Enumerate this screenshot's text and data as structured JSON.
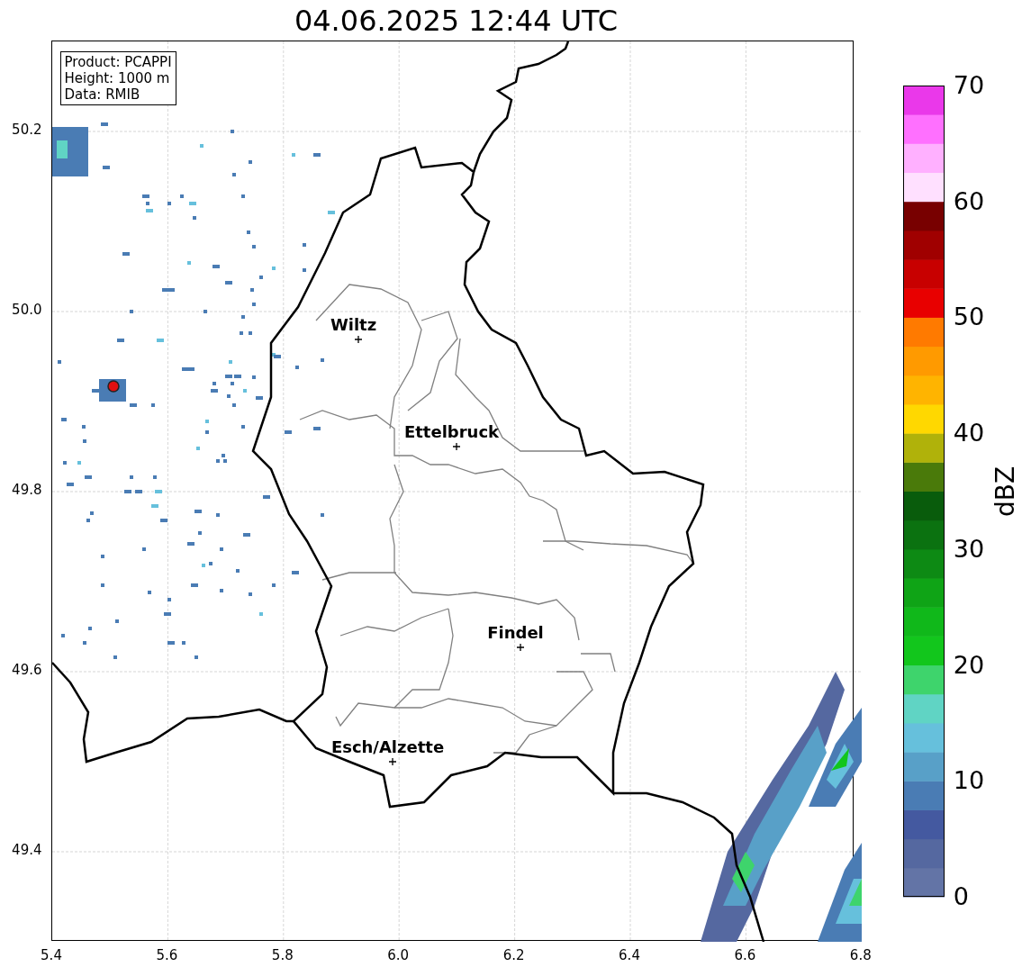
{
  "title": "04.06.2025 12:44 UTC",
  "info_box": [
    "Product: PCAPPI",
    "Height: 1000 m",
    "Data: RMIB"
  ],
  "x_ticks": [
    "5.4",
    "5.6",
    "5.8",
    "6.0",
    "6.2",
    "6.4",
    "6.6",
    "6.8"
  ],
  "y_ticks": [
    "50.2",
    "50.0",
    "49.8",
    "49.6",
    "49.4"
  ],
  "cities": [
    {
      "name": "Wiltz"
    },
    {
      "name": "Ettelbruck"
    },
    {
      "name": "Findel"
    },
    {
      "name": "Esch/Alzette"
    }
  ],
  "colorbar": {
    "label": "dBZ",
    "ticks": [
      "70",
      "60",
      "50",
      "40",
      "30",
      "20",
      "10",
      "0"
    ]
  }
}
